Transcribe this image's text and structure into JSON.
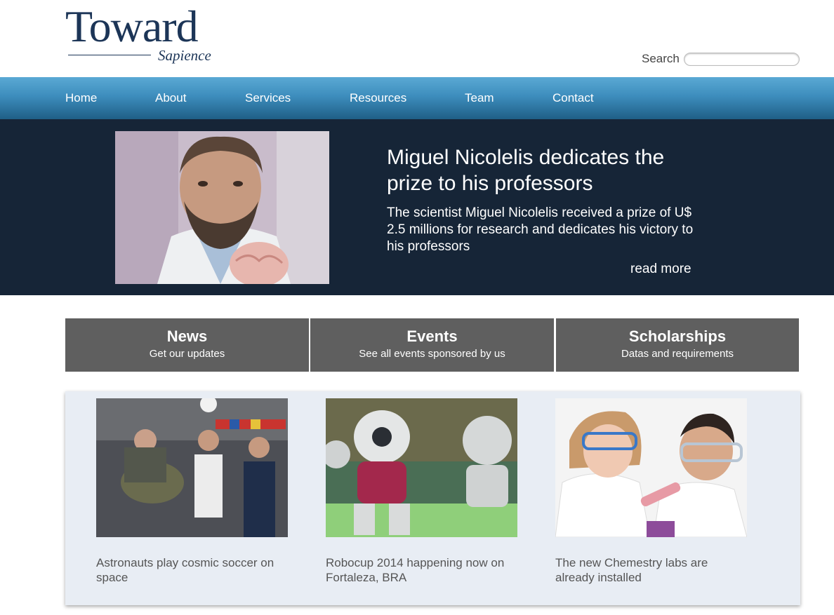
{
  "header": {
    "logo_main": "Toward",
    "logo_sub": "Sapience",
    "search_label": "Search",
    "search_placeholder": ""
  },
  "nav": {
    "items": [
      "Home",
      "About",
      "Services",
      "Resources",
      "Team",
      "Contact"
    ]
  },
  "hero": {
    "title": "Miguel Nicolelis dedicates the prize to his professors",
    "text": "The scientist Miguel Nicolelis received a prize of U$ 2.5 millions for research and dedicates his victory to his professors",
    "read_more": "read more",
    "image": "portrait-scientist-with-brain-model"
  },
  "boxes": [
    {
      "title": "News",
      "subtitle": "Get our updates"
    },
    {
      "title": "Events",
      "subtitle": "See all events sponsored by us"
    },
    {
      "title": "Scholarships",
      "subtitle": "Datas and requirements"
    }
  ],
  "cards": [
    {
      "caption": "Astronauts play cosmic soccer on space",
      "image": "astronauts-soccer-photo"
    },
    {
      "caption": "Robocup 2014 happening now on Fortaleza, BRA",
      "image": "robots-robocup-photo"
    },
    {
      "caption": "The new Chemestry labs are already installed",
      "image": "chemistry-lab-photo"
    }
  ],
  "colors": {
    "brand": "#1c3557",
    "nav_top": "#5aa9d4",
    "nav_bottom": "#1f5f86",
    "hero_bg": "#162537",
    "box_bg": "#5f5f5f",
    "panel_bg": "#e8edf4"
  }
}
